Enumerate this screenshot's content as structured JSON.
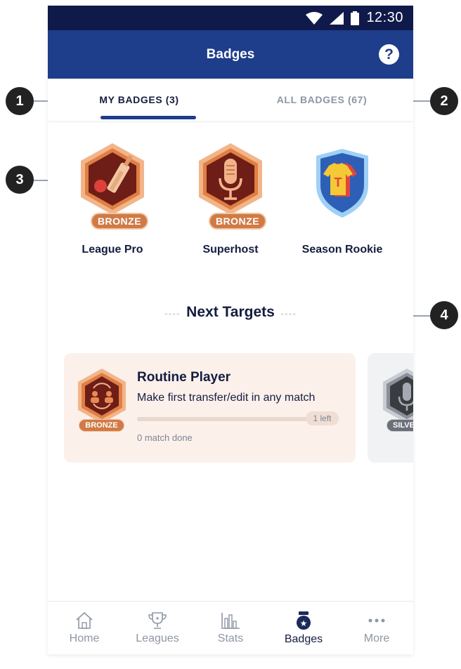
{
  "status_bar": {
    "time": "12:30"
  },
  "header": {
    "title": "Badges",
    "help_icon": "?"
  },
  "tabs": [
    {
      "label": "MY BADGES (3)",
      "active": true
    },
    {
      "label": "ALL BADGES (67)",
      "active": false
    }
  ],
  "badges": [
    {
      "name": "League Pro",
      "tier": "BRONZE",
      "icon": "cricket-bat-icon"
    },
    {
      "name": "Superhost",
      "tier": "BRONZE",
      "icon": "microphone-icon"
    },
    {
      "name": "Season Rookie",
      "tier": "",
      "icon": "jersey-shield-icon"
    }
  ],
  "next_targets": {
    "title": "Next Targets",
    "dashes_left": "----",
    "dashes_right": "----",
    "cards": [
      {
        "title": "Routine Player",
        "description": "Make first transfer/edit in any match",
        "tier": "BRONZE",
        "left_label": "1 left",
        "done_label": "0 match done",
        "progress": 0.0
      },
      {
        "tier": "SILVE"
      }
    ]
  },
  "bottom_nav": [
    {
      "label": "Home",
      "icon": "home-icon"
    },
    {
      "label": "Leagues",
      "icon": "trophy-icon"
    },
    {
      "label": "Stats",
      "icon": "bar-chart-icon"
    },
    {
      "label": "Badges",
      "icon": "medal-icon",
      "active": true
    },
    {
      "label": "More",
      "icon": "more-icon"
    }
  ],
  "callouts": [
    "1",
    "2",
    "3",
    "4"
  ],
  "colors": {
    "primary": "#1e3d8a",
    "status_bar": "#0f1a4a",
    "bronze": "#d07a45",
    "card_bg": "#fcf0eb"
  }
}
